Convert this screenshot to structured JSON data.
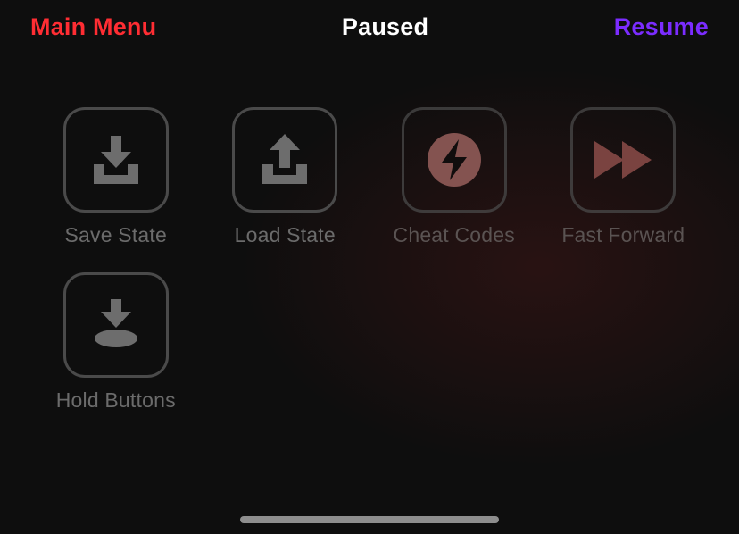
{
  "header": {
    "main_menu": "Main Menu",
    "title": "Paused",
    "resume": "Resume"
  },
  "actions": {
    "save_state": "Save State",
    "load_state": "Load State",
    "cheat_codes": "Cheat Codes",
    "fast_forward": "Fast Forward",
    "hold_buttons": "Hold Buttons"
  },
  "colors": {
    "main_menu": "#ff2d33",
    "resume": "#7b2cff",
    "icon_gray": "#6d6d6d",
    "icon_dim_red": "#7a4340",
    "badge_fill": "#845350"
  }
}
